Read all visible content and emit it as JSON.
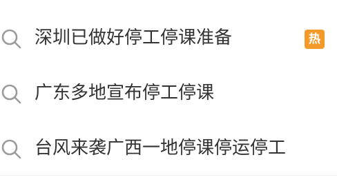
{
  "hot_list": {
    "items": [
      {
        "text": "深圳已做好停工停课准备",
        "badge": "热",
        "badge_color": "#f39a2b"
      },
      {
        "text": "广东多地宣布停工停课",
        "badge": ""
      },
      {
        "text": "台风来袭广西一地停课停运停工",
        "badge": ""
      }
    ],
    "icon": "search-icon",
    "text_color": "#333333",
    "icon_color": "#9a9a9a"
  }
}
